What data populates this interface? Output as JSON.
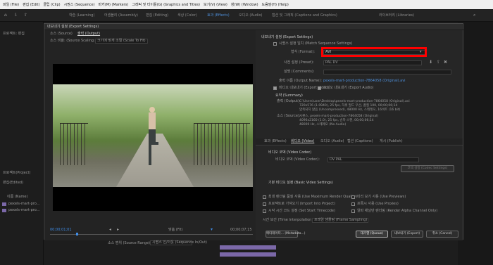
{
  "menu": [
    "파일 (File)",
    "편집 (Edit)",
    "클립 (Clip)",
    "시퀀스 (Sequence)",
    "마커(M) (Markers)",
    "그래픽 및 타이틀(G) (Graphics and Titles)",
    "보기(V) (View)",
    "창(W) (Window)",
    "도움말(H) (Help)"
  ],
  "workspaces": [
    "학습 (Learning)",
    "어셈블리 (Assembly)",
    "편집 (Editing)",
    "색상 (Color)",
    "효과 (Effects)",
    "오디오 (Audio)",
    "캡션 및 그래픽 (Captions and Graphics)",
    "라이브러리 (Libraries)"
  ],
  "active_workspace": "효과 (Effects)",
  "left_panel": {
    "title": "프로젝트: 편집",
    "items": [
      "프로젝트(Project)",
      "편집(Edited)",
      "이름 (Name)",
      "pexels-mart-pro...",
      "pexels-mart-pro..."
    ]
  },
  "dialog": {
    "title": "내보내기 설정 (Export Settings)",
    "tabs": [
      "소스 (Source)",
      "출력 (Output)"
    ],
    "source_scaling_label": "소스 비율: (Source Scaling:)",
    "source_scaling_value": "크기에 맞게 조절 (Scale To Fit)",
    "timecode_in": "00;00;01;01",
    "fit_label": "맞춤 (Fit)",
    "timecode_out": "00;00;07;15",
    "source_range_label": "소스 범위 (Source Range):",
    "source_range_value": "시퀀스 인/아웃 (Sequence In/Out)",
    "export_settings": {
      "header": "내보내기 설정 (Export Settings)",
      "match_sequence": "시퀀스 설정 일치 (Match Sequence Settings)",
      "format_label": "형식 (Format):",
      "format_value": "AVI",
      "preset_label": "사전 설정 (Preset):",
      "preset_value": "PAL DV",
      "comments_label": "설명 (Comments):",
      "output_name_label": "출력 이름 (Output Name):",
      "output_name_value": "pexels-mart-production-7864058 (Original).avi",
      "export_video": "비디오 내보내기 (Export Video)",
      "export_audio": "오디오 내보내기 (Export Audio)",
      "summary_header": "요약 (Summary)",
      "output_label": "출력 (Output):",
      "output_lines": [
        "C:\\Users\\user\\Desktop\\pexels-mart-production-7864058 (Original).avi",
        "720x576 (1.0940), 25 fps, 하위 필드 우선, 품질 100, 00;00;06;14",
        "압축되지 않음 (Uncompressed), 48000 Hz, 스테레오, 16비트 (16 bit)"
      ],
      "source_label": "소스 (Source):",
      "source_lines": [
        "시퀀스, pexels-mart-production-7864058 (Original)",
        "4096x2160 (1.0), 25 fps, 순차 스캔, 00;00;06;14",
        "48000 Hz, 스테레오 (No Audio)"
      ]
    },
    "bottom_tabs": [
      "효과 (Effects)",
      "비디오 (Video)",
      "오디오 (Audio)",
      "캡션 (Captions)",
      "게시 (Publish)"
    ],
    "video_codec_header": "비디오 코덱 (Video Codec)",
    "video_codec_label": "비디오 코덱 (Video Codec):",
    "video_codec_value": "DV PAL",
    "codec_settings_button": "코덱 설정 (Codec Settings)",
    "basic_video_header": "기본 비디오 설정 (Basic Video Settings)",
    "options": [
      "최대 렌더링 품질 사용 (Use Maximum Render Quality)",
      "미리 보기 사용 (Use Previews)",
      "프로젝트로 가져오기 (Import Into Project)",
      "프록시 사용 (Use Proxies)",
      "시작 시간 코드 설정 (Set Start Timecode)",
      "알파 채널만 렌더링 (Render Alpha Channel Only)"
    ],
    "interp_label": "시간 보간 (Time Interpolation):",
    "interp_value": "프레임 샘플링 (Frame Sampling)",
    "buttons": {
      "metadata": "메타데이터... (Metadata...)",
      "queue": "대기열 (Queue)",
      "export": "내보내기 (Export)",
      "cancel": "취소 (Cancel)"
    }
  },
  "colors": {
    "highlight": "#ff0000",
    "link": "#4e8ed8",
    "timecode": "#3f8de8",
    "clip": "#7b68a8"
  }
}
